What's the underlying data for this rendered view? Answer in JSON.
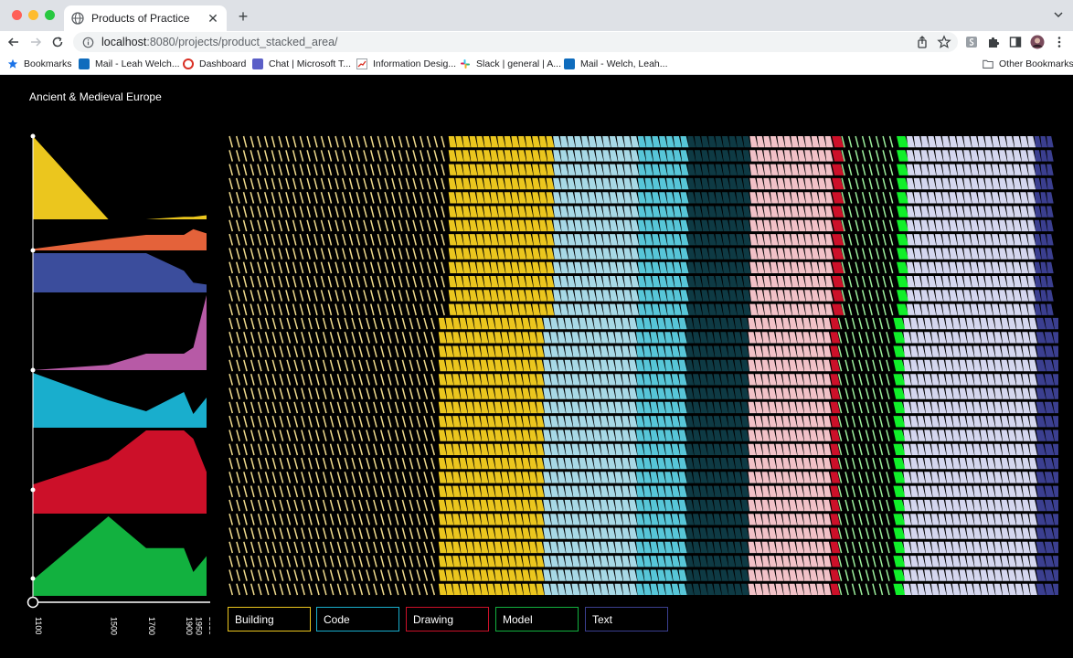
{
  "browser": {
    "tab_title": "Products of Practice",
    "url_host": "localhost",
    "url_path": ":8080/projects/product_stacked_area/",
    "bookmarks": [
      {
        "label": "Bookmarks",
        "icon": "star-icon"
      },
      {
        "label": "Mail - Leah Welch...",
        "icon": "outlook-icon"
      },
      {
        "label": "Dashboard",
        "icon": "dashboard-icon"
      },
      {
        "label": "Chat | Microsoft T...",
        "icon": "teams-icon"
      },
      {
        "label": "Information Desig...",
        "icon": "chart-icon"
      },
      {
        "label": "Slack | general | A...",
        "icon": "slack-icon"
      },
      {
        "label": "Mail - Welch, Leah...",
        "icon": "outlook-icon"
      }
    ],
    "other_bookmarks": "Other Bookmarks"
  },
  "page": {
    "title": "Ancient & Medieval Europe",
    "legend": [
      {
        "label": "Building",
        "color": "#ebc61e"
      },
      {
        "label": "Code",
        "color": "#19aecd"
      },
      {
        "label": "Drawing",
        "color": "#cc1029"
      },
      {
        "label": "Model",
        "color": "#12b13f"
      },
      {
        "label": "Text",
        "color": "#3b3f90"
      }
    ]
  },
  "chart_data": [
    {
      "type": "area",
      "x": [
        1100,
        1500,
        1700,
        1900,
        1950,
        2020
      ],
      "x_ticks": [
        "1100",
        "1500",
        "1700",
        "1900",
        "1950",
        "2020"
      ],
      "series": [
        {
          "color": "#ebc61e",
          "values": [
            1.0,
            0.0,
            0.0,
            0.03,
            0.03,
            0.05
          ]
        },
        {
          "color": "#e4623a",
          "values": [
            0.05,
            0.4,
            0.55,
            0.55,
            0.75,
            0.6
          ]
        },
        {
          "color": "#3b4d9c",
          "values": [
            1.0,
            1.0,
            1.0,
            0.55,
            0.25,
            0.2
          ]
        },
        {
          "color": "#b75aa6",
          "values": [
            0.0,
            0.07,
            0.22,
            0.22,
            0.3,
            1.0
          ]
        },
        {
          "color": "#19aecd",
          "values": [
            1.0,
            0.5,
            0.3,
            0.65,
            0.25,
            0.55
          ]
        },
        {
          "color": "#cc1029",
          "values": [
            0.35,
            0.65,
            1.0,
            1.0,
            0.9,
            0.5
          ]
        },
        {
          "color": "#12b13f",
          "values": [
            0.2,
            1.0,
            0.6,
            0.6,
            0.3,
            0.5
          ]
        }
      ]
    },
    {
      "type": "area",
      "rows": 33,
      "series": [
        {
          "color": "#f1dc8e",
          "style": "hatched",
          "values": [
            0.264,
            0.252
          ]
        },
        {
          "color": "#ebc61e",
          "values": [
            0.126,
            0.126
          ]
        },
        {
          "color": "#a8d9e6",
          "values": [
            0.102,
            0.112
          ]
        },
        {
          "color": "#57c6d8",
          "values": [
            0.06,
            0.06
          ]
        },
        {
          "color": "#0e3a44",
          "values": [
            0.075,
            0.075
          ]
        },
        {
          "color": "#f2c2c8",
          "values": [
            0.099,
            0.099
          ]
        },
        {
          "color": "#cc1029",
          "values": [
            0.012,
            0.01
          ]
        },
        {
          "color": "#9df09d",
          "style": "hatched",
          "values": [
            0.066,
            0.066
          ]
        },
        {
          "color": "#11ef2a",
          "values": [
            0.012,
            0.012
          ]
        },
        {
          "color": "#d5d7ef",
          "values": [
            0.154,
            0.16
          ]
        },
        {
          "color": "#3b3f90",
          "values": [
            0.022,
            0.03
          ]
        }
      ]
    }
  ]
}
